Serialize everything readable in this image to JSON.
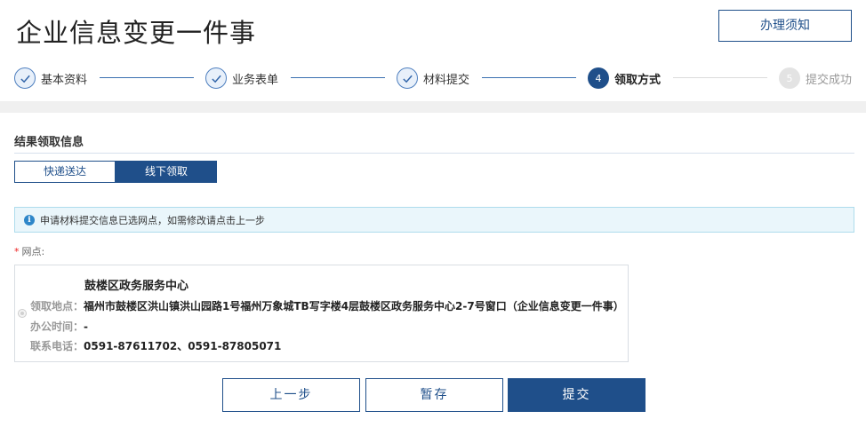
{
  "header": {
    "title": "企业信息变更一件事",
    "notice_button": "办理须知"
  },
  "steps": [
    {
      "label": "基本资料",
      "number": "1",
      "state": "done"
    },
    {
      "label": "业务表单",
      "number": "2",
      "state": "done"
    },
    {
      "label": "材料提交",
      "number": "3",
      "state": "done"
    },
    {
      "label": "领取方式",
      "number": "4",
      "state": "active"
    },
    {
      "label": "提交成功",
      "number": "5",
      "state": "pending"
    }
  ],
  "section": {
    "title": "结果领取信息",
    "tabs": [
      {
        "label": "快递送达",
        "selected": false
      },
      {
        "label": "线下领取",
        "selected": true
      }
    ],
    "alert": "申请材料提交信息已选网点，如需修改请点击上一步",
    "field_label": "网点:",
    "required_mark": "*"
  },
  "point": {
    "name": "鼓楼区政务服务中心",
    "address_key": "领取地点：",
    "address": "福州市鼓楼区洪山镇洪山园路1号福州万象城TB写字楼4层鼓楼区政务服务中心2-7号窗口（企业信息变更一件事）",
    "hours_key": "办公时间：",
    "hours": "-",
    "phone_key": "联系电话：",
    "phone": "0591-87611702、0591-87805071"
  },
  "actions": {
    "prev": "上一步",
    "save": "暂存",
    "submit": "提交"
  },
  "colors": {
    "primary": "#1f4f8a",
    "alert_bg": "#eaf6fb",
    "required": "#e22222"
  }
}
